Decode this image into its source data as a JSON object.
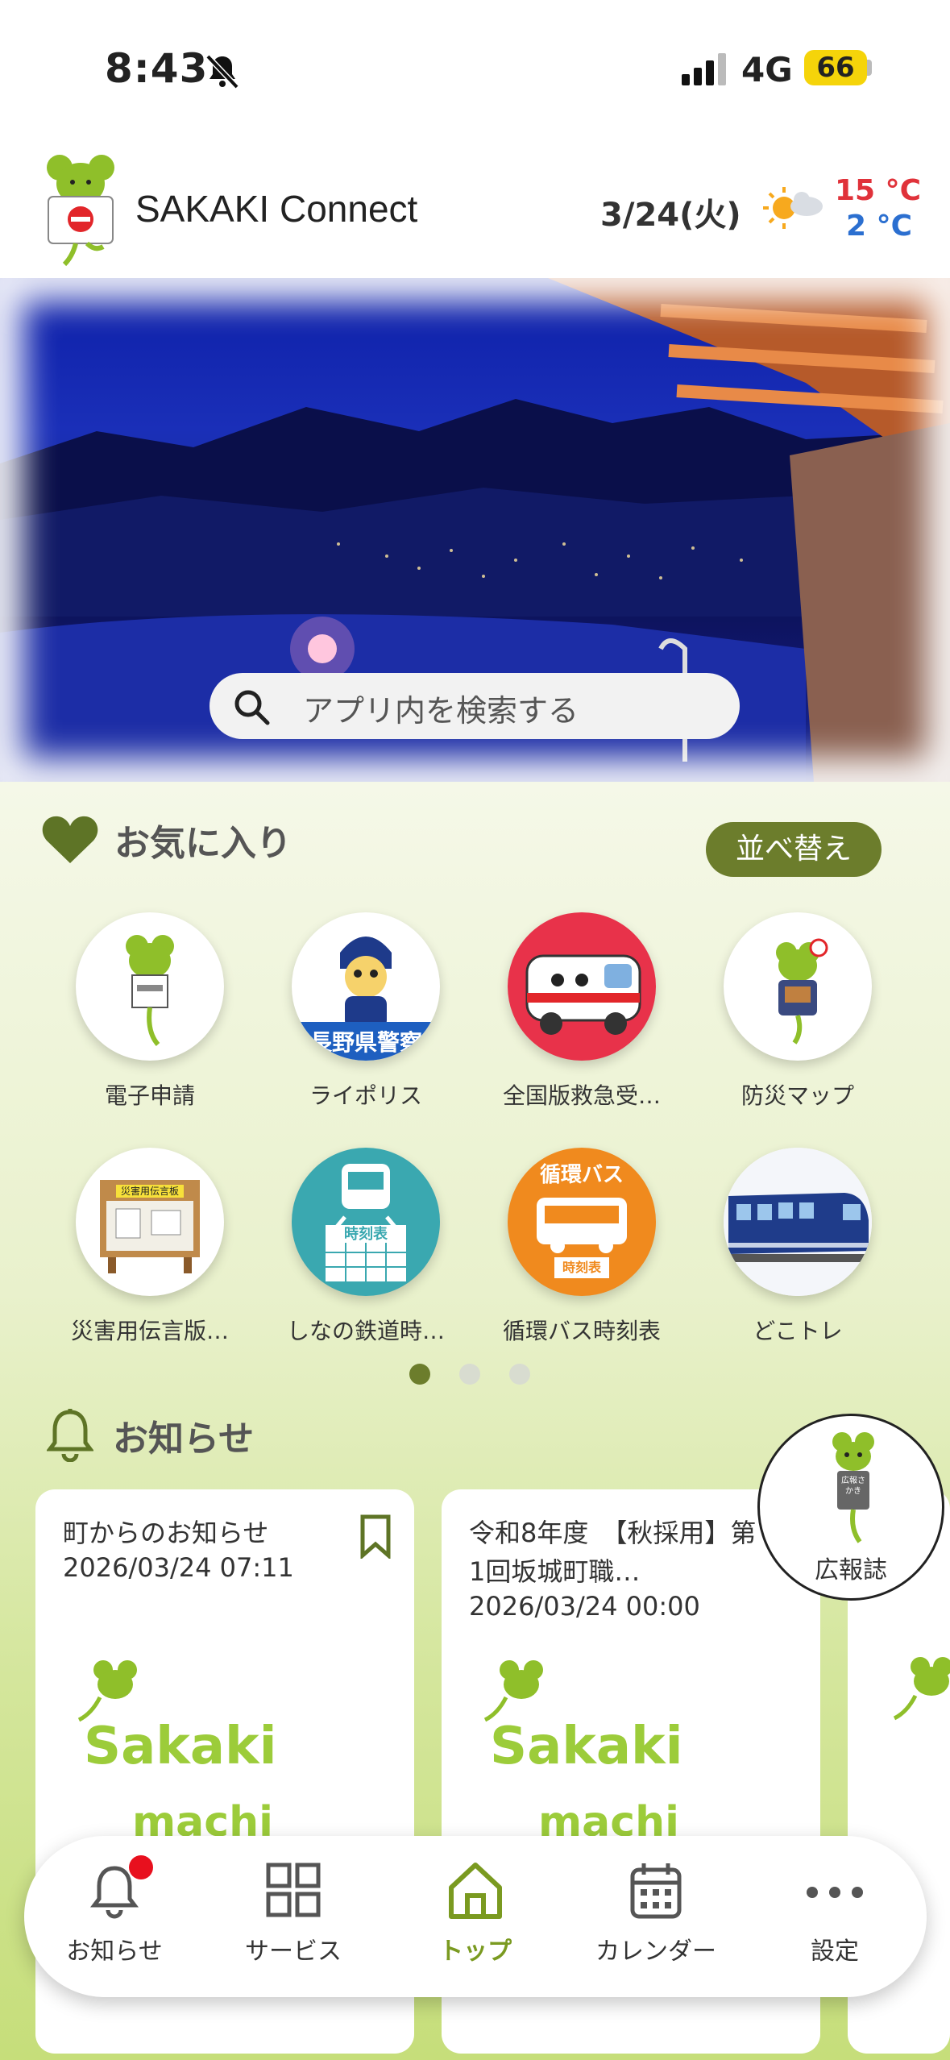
{
  "status_bar": {
    "time": "8:43",
    "network": "4G",
    "battery": "66"
  },
  "header": {
    "app_title": "SAKAKI Connect",
    "date": "3/24(火)",
    "temp_high": "15 °C",
    "temp_low": "2 °C",
    "weather_icon": "sun-cloud-icon"
  },
  "search": {
    "placeholder": "アプリ内を検索する"
  },
  "favorites": {
    "title": "お気に入り",
    "sort_label": "並べ替え",
    "items": [
      {
        "label": "電子申請"
      },
      {
        "label": "ライポリス",
        "banner": "長野県警察"
      },
      {
        "label": "全国版救急受…"
      },
      {
        "label": "防災マップ"
      },
      {
        "label": "災害用伝言版…",
        "sign": "災害用伝言板"
      },
      {
        "label": "しなの鉄道時…",
        "icon_text": "時刻表"
      },
      {
        "label": "循環バス時刻表",
        "icon_text_top": "循環バス",
        "icon_text_bottom": "時刻表"
      },
      {
        "label": "どこトレ"
      }
    ],
    "page_count": 3,
    "active_page": 1
  },
  "notices": {
    "title": "お知らせ",
    "cards": [
      {
        "category": "町からのお知らせ",
        "date": "2026/03/24 07:11",
        "art_line1": "Sakaki",
        "art_line2": "machi"
      },
      {
        "category": "令和8年度　【秋採用】第1回坂城町職…",
        "date": "2026/03/24 00:00",
        "art_line1": "Sakaki",
        "art_line2": "machi"
      }
    ]
  },
  "floating_button": {
    "label": "広報誌",
    "sign_text": "広報さかき"
  },
  "tabbar": {
    "tabs": [
      {
        "label": "お知らせ"
      },
      {
        "label": "サービス"
      },
      {
        "label": "トップ"
      },
      {
        "label": "カレンダー"
      },
      {
        "label": "設定"
      }
    ]
  },
  "colors": {
    "accent": "#6c7d2c",
    "active_tab": "#7a9a20",
    "temp_high": "#e0323a",
    "temp_low": "#2b6fd0"
  }
}
